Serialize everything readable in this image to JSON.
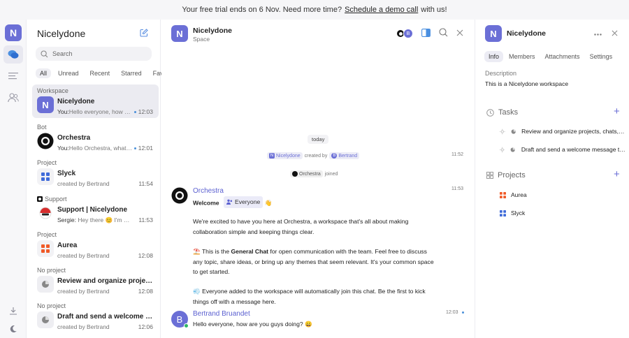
{
  "banner": {
    "prefix": "Your free trial ends on 6 Nov. Need more time?",
    "link": "Schedule a demo call",
    "suffix": "with us!"
  },
  "rail": {
    "logo_letter": "N"
  },
  "sidebar": {
    "title": "Nicelydone",
    "search_placeholder": "Search",
    "filters": [
      "All",
      "Unread",
      "Recent",
      "Starred",
      "Favorite"
    ],
    "groups": [
      {
        "label": "Workspace",
        "name": "Nicelydone",
        "sub_author": "You:",
        "sub_text": "Hello everyone, how are you guys doing?",
        "time": "12:03",
        "unread_dot": true
      },
      {
        "label": "Bot",
        "name": "Orchestra",
        "sub_author": "You:",
        "sub_text": "Hello Orchestra, what can you do?",
        "time": "12:01",
        "unread_dot": true
      },
      {
        "label": "Project",
        "name": "Slyck",
        "sub_author": "",
        "sub_text": "created by Bertrand",
        "time": "11:54",
        "unread_dot": false
      },
      {
        "label": "Support",
        "name": "Support | Nicelydone",
        "sub_author": "Sergie:",
        "sub_text": "Hey there 😊 I'm Sergie from Nicelydone",
        "time": "11:53",
        "unread_dot": false
      },
      {
        "label": "Project",
        "name": "Aurea",
        "sub_author": "",
        "sub_text": "created by Bertrand",
        "time": "12:08",
        "unread_dot": false
      },
      {
        "label": "No project",
        "name": "Review and organize projects, chats, and tasks",
        "sub_author": "",
        "sub_text": "created by Bertrand",
        "time": "12:08",
        "unread_dot": false
      },
      {
        "label": "No project",
        "name": "Draft and send a welcome message to the team",
        "sub_author": "",
        "sub_text": "created by Bertrand",
        "time": "12:06",
        "unread_dot": false
      }
    ]
  },
  "main": {
    "title": "Nicelydone",
    "subtitle": "Space",
    "avatar_letter": "N",
    "participant_letter": "B",
    "today": "today",
    "system1": {
      "workspace": "Nicelydone",
      "created_by": "created by",
      "user": "Bertrand",
      "time": "11:52"
    },
    "system2": {
      "bot": "Orchestra",
      "joined": "joined"
    },
    "bot_message": {
      "author": "Orchestra",
      "time": "11:53",
      "welcome": "Welcome",
      "everyone": "Everyone",
      "wave": "👋",
      "p1": "We're excited to have you here at Orchestra, a workspace that's all about making collaboration simple and keeping things clear.",
      "p2_icon": "⛱️",
      "p2_a": "This is the",
      "p2_bold": "General Chat",
      "p2_b": "for open communication with the team. Feel free to discuss any topic, share ideas, or bring up any themes that seem relevant. It's your common space to get started.",
      "p3_icon": "💨",
      "p3": "Everyone added to the workspace will automatically join this chat. Be the first to kick things off with a message here."
    },
    "user_message": {
      "author": "Bertrand Bruandet",
      "avatar_letter": "B",
      "time": "12:03",
      "text": "Hello everyone, how are you guys doing? 😀"
    }
  },
  "details": {
    "title": "Nicelydone",
    "avatar_letter": "N",
    "tabs": [
      "Info",
      "Members",
      "Attachments",
      "Settings"
    ],
    "description_label": "Description",
    "description": "This is a Nicelydone workspace",
    "tasks_label": "Tasks",
    "tasks": [
      "Review and organize projects, chats, and tasks",
      "Draft and send a welcome message to the team"
    ],
    "projects_label": "Projects",
    "projects": [
      {
        "name": "Aurea",
        "color": "#f05a28"
      },
      {
        "name": "Slyck",
        "color": "#3f6bd9"
      }
    ]
  },
  "colors": {
    "accent": "#6b6fd6",
    "link": "#5a5fd0",
    "online": "#2fb567"
  }
}
